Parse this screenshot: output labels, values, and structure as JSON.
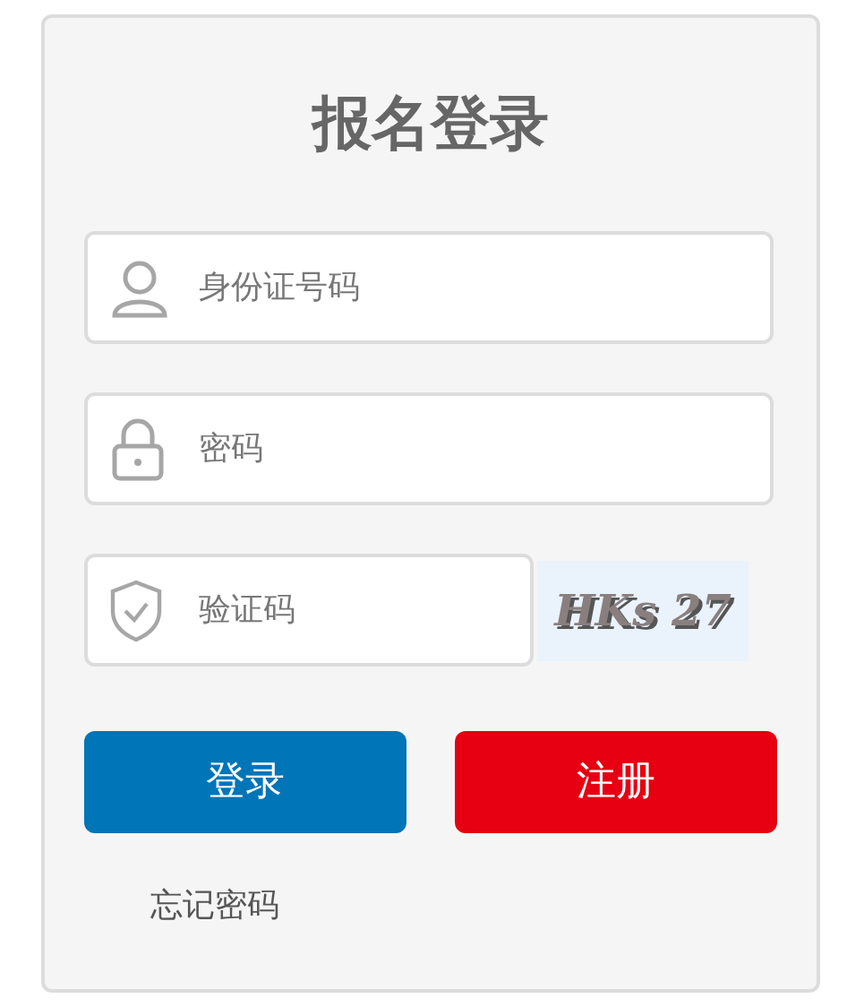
{
  "title": "报名登录",
  "fields": [
    {
      "kind": "user",
      "placeholder": "身份证号码"
    },
    {
      "kind": "lock",
      "placeholder": "密码"
    },
    {
      "kind": "shield",
      "placeholder": "验证码"
    }
  ],
  "captcha": {
    "text": "HKs 27"
  },
  "buttons": [
    {
      "kind": "primary",
      "label": "登录"
    },
    {
      "kind": "danger",
      "label": "注册"
    }
  ],
  "forgot_link": "忘记密码"
}
